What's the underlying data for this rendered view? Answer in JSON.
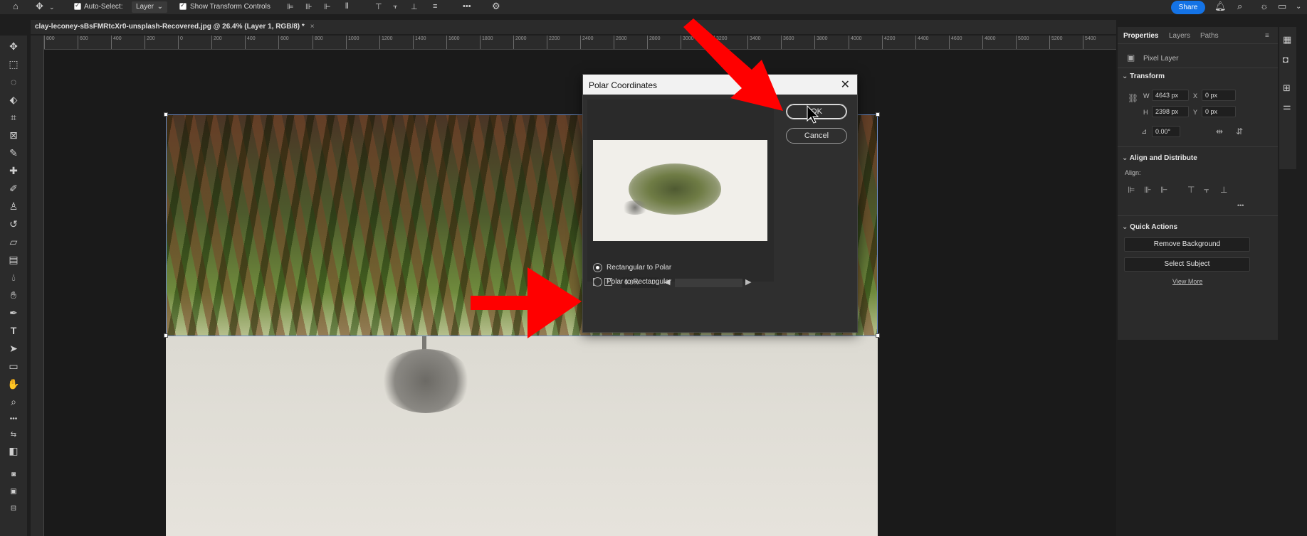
{
  "topbar": {
    "auto_select_label": "Auto-Select:",
    "layer_select": "Layer",
    "transform_controls_label": "Show Transform Controls",
    "more": "•••",
    "share_label": "Share"
  },
  "document": {
    "tab_title": "clay-leconey-sBsFMRtcXr0-unsplash-Recovered.jpg @ 26.4% (Layer 1, RGB/8) *",
    "close": "×"
  },
  "ruler": {
    "ticks": [
      "800",
      "600",
      "400",
      "200",
      "0",
      "200",
      "400",
      "600",
      "800",
      "1000",
      "1200",
      "1400",
      "1600",
      "1800",
      "2000",
      "2200",
      "2400",
      "2600",
      "2800",
      "3000",
      "3200",
      "3400",
      "3600",
      "3800",
      "4000",
      "4200",
      "4400",
      "4600",
      "4800",
      "5000",
      "5200",
      "5400"
    ]
  },
  "panel": {
    "tabs": [
      "Properties",
      "Layers",
      "Paths"
    ],
    "pixel_layer": "Pixel Layer",
    "transform": {
      "title": "Transform",
      "w_label": "W",
      "w_value": "4643 px",
      "x_label": "X",
      "x_value": "0 px",
      "h_label": "H",
      "h_value": "2398 px",
      "y_label": "Y",
      "y_value": "0 px",
      "angle_value": "0.00°"
    },
    "align": {
      "title": "Align and Distribute",
      "align_label": "Align:",
      "more": "•••"
    },
    "quick_actions": {
      "title": "Quick Actions",
      "remove_background": "Remove Background",
      "select_subject": "Select Subject",
      "view_more": "View More"
    }
  },
  "dialog": {
    "title": "Polar Coordinates",
    "ok_label": "OK",
    "cancel_label": "Cancel",
    "zoom_value": "6.3%",
    "options": [
      {
        "label": "Rectangular to Polar",
        "selected": true
      },
      {
        "label": "Polar to Rectangular",
        "selected": false
      }
    ]
  },
  "colors": {
    "accent": "#1473e6",
    "annotation_arrow": "#ff0000",
    "panel_bg": "#2b2b2b"
  }
}
